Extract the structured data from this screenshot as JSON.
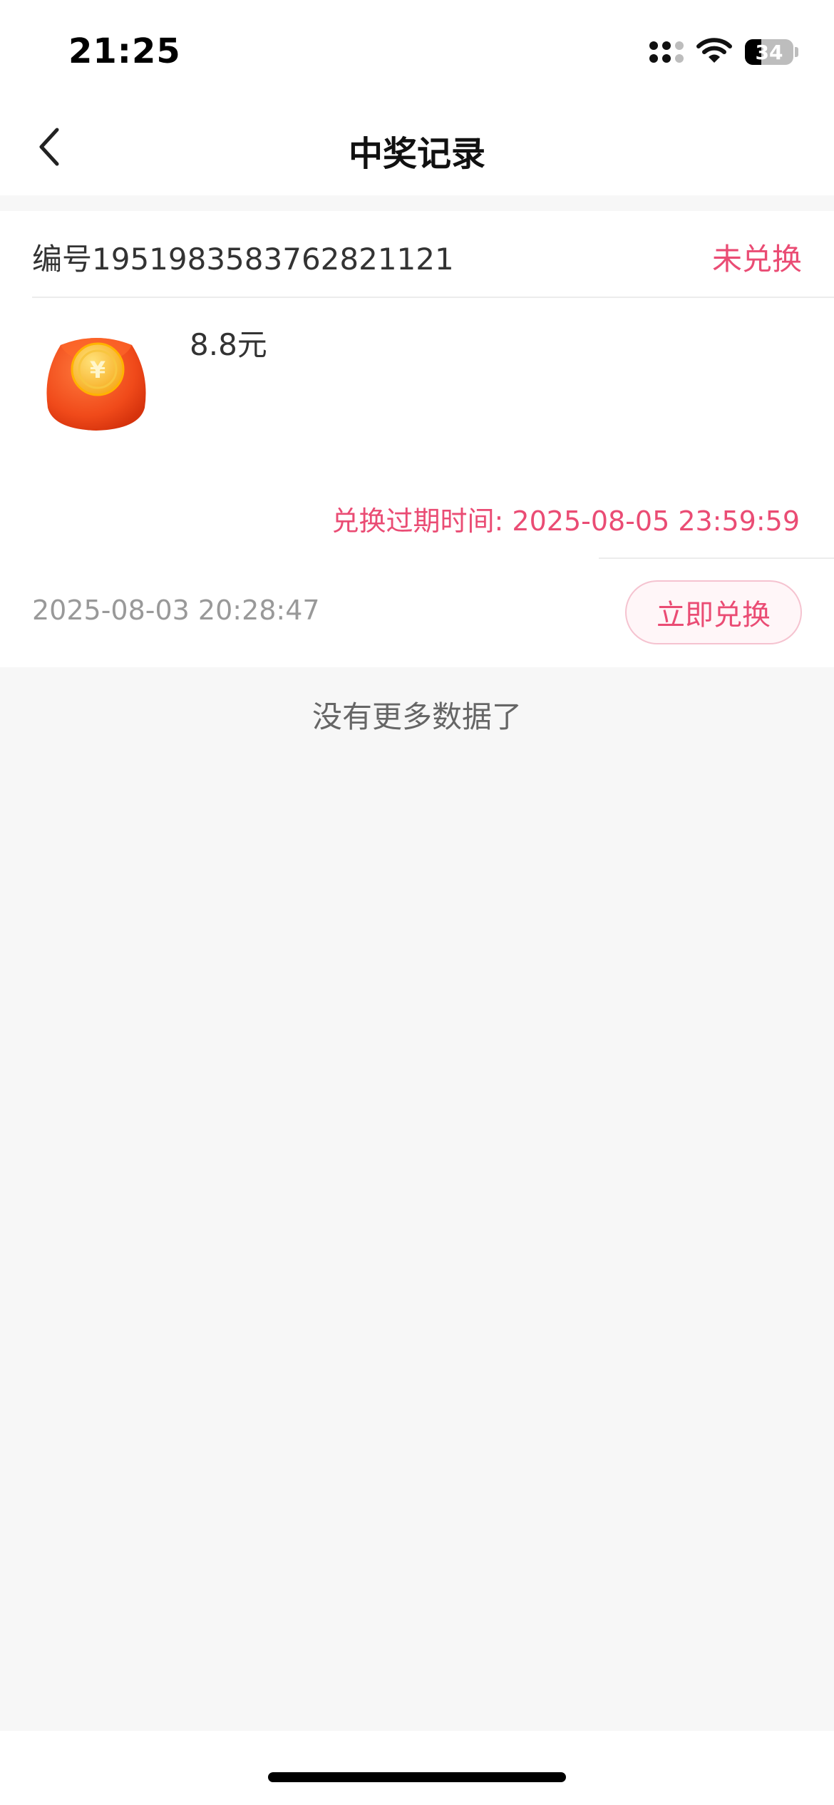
{
  "status_bar": {
    "time": "21:25",
    "battery_level": "34",
    "battery_fraction": 0.34,
    "icons": [
      "signal-icon",
      "wifi-icon",
      "battery-icon"
    ]
  },
  "nav": {
    "title": "中奖记录",
    "back_icon": "chevron-left-icon"
  },
  "record": {
    "id_text": "编号1951983583762821121",
    "status": "未兑换",
    "prize_name": "8.8元",
    "prize_icon": "red-envelope-icon",
    "expire_text": "兑换过期时间: 2025-08-05 23:59:59",
    "win_time": "2025-08-03 20:28:47",
    "redeem_label": "立即兑换"
  },
  "list_footer": "没有更多数据了",
  "colors": {
    "accent": "#ea4c74",
    "text_primary": "#333333",
    "text_secondary": "#999999",
    "background": "#f7f7f7"
  }
}
